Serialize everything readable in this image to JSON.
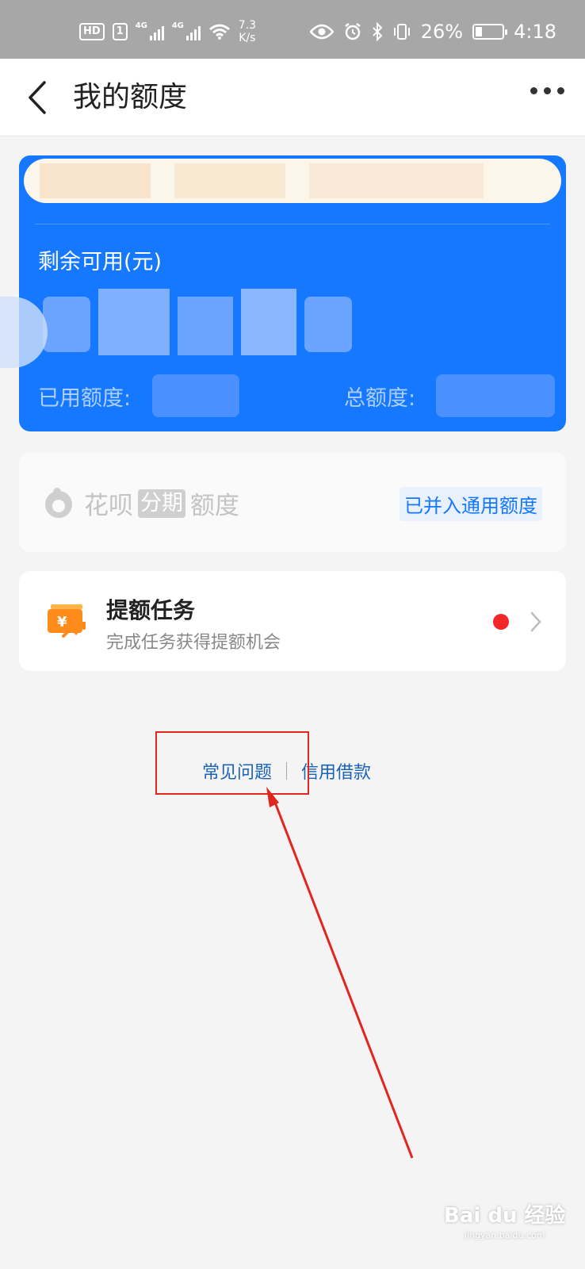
{
  "status_bar": {
    "hd": "HD",
    "sim": "1",
    "signal_label": "4G",
    "speed_value": "7.3",
    "speed_unit": "K/s",
    "battery": "26%",
    "battery_level": 0.26,
    "time": "4:18"
  },
  "navbar": {
    "title": "我的额度"
  },
  "quota_card": {
    "remaining_label": "剩余可用(元)",
    "used_label": "已用额度:",
    "total_label": "总额度:"
  },
  "huabei": {
    "brand": "花呗",
    "tag": "分期",
    "suffix": "额度",
    "badge": "已并入通用额度"
  },
  "task": {
    "title": "提额任务",
    "subtitle": "完成任务获得提额机会"
  },
  "links": {
    "faq": "常见问题",
    "credit_loan": "信用借款"
  },
  "watermark": {
    "brand": "Bai du 经验",
    "url": "jingyan.baidu.com"
  },
  "colors": {
    "brand_blue": "#1677ff",
    "alert_red": "#f02828",
    "annotation_red": "#e0261d"
  }
}
